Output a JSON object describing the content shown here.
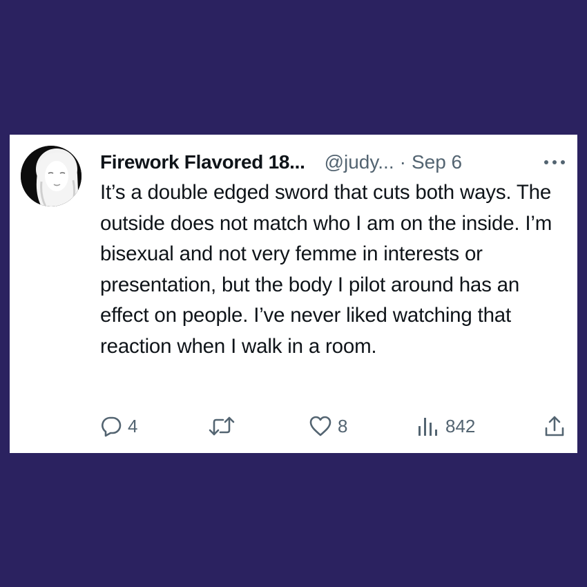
{
  "tweet": {
    "display_name": "Firework Flavored 18...",
    "handle": "@judy...",
    "separator": "·",
    "date": "Sep 6",
    "text": "It’s a double edged sword that cuts both ways. The outside does not match who I am on the inside. I’m bisexual and not very femme in interests or presentation, but the body I pilot around has an effect on people. I’ve never liked watching that reaction when I walk in a room.",
    "more_icon": "more-horizontal-icon",
    "avatar_icon": "avatar"
  },
  "actions": {
    "reply": {
      "icon": "reply-icon",
      "count": "4"
    },
    "retweet": {
      "icon": "retweet-icon",
      "count": ""
    },
    "like": {
      "icon": "heart-icon",
      "count": "8"
    },
    "views": {
      "icon": "views-chart-icon",
      "count": "842"
    },
    "share": {
      "icon": "share-icon"
    }
  },
  "colors": {
    "background": "#2b2260",
    "card": "#ffffff",
    "text_primary": "#0f1419",
    "text_secondary": "#536471"
  }
}
